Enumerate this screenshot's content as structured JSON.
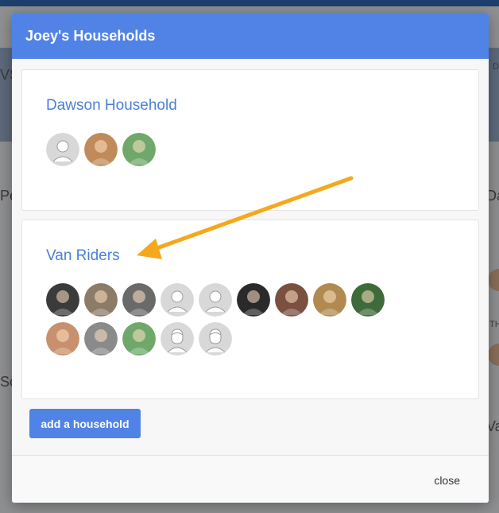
{
  "modal": {
    "title": "Joey's Households",
    "add_label": "add a household",
    "close_label": "close"
  },
  "households": [
    {
      "name": "Dawson Household",
      "members": [
        {
          "kind": "placeholder-adult",
          "color": "#d8d8d8"
        },
        {
          "kind": "photo",
          "color": "#c08a5a"
        },
        {
          "kind": "photo",
          "color": "#6fa86a"
        }
      ]
    },
    {
      "name": "Van Riders",
      "members": [
        {
          "kind": "photo",
          "color": "#3b3b3b"
        },
        {
          "kind": "photo",
          "color": "#8c7b66"
        },
        {
          "kind": "photo",
          "color": "#6a6a6a"
        },
        {
          "kind": "placeholder-adult",
          "color": "#d8d8d8"
        },
        {
          "kind": "placeholder-adult",
          "color": "#d8d8d8"
        },
        {
          "kind": "photo",
          "color": "#2a2a2a"
        },
        {
          "kind": "photo",
          "color": "#7a5040"
        },
        {
          "kind": "photo",
          "color": "#b08a50"
        },
        {
          "kind": "photo",
          "color": "#3f6a3a"
        },
        {
          "kind": "photo",
          "color": "#c8906c"
        },
        {
          "kind": "photo",
          "color": "#8a8a8a"
        },
        {
          "kind": "photo",
          "color": "#6fa86a"
        },
        {
          "kind": "placeholder-child",
          "color": "#d8d8d8"
        },
        {
          "kind": "placeholder-child",
          "color": "#d8d8d8"
        }
      ]
    }
  ],
  "annotation": {
    "color": "#f5a81c"
  },
  "background_fragments": [
    "VS",
    "Pe",
    "Da",
    "So",
    "Va",
    "D",
    "Th",
    "TH"
  ]
}
